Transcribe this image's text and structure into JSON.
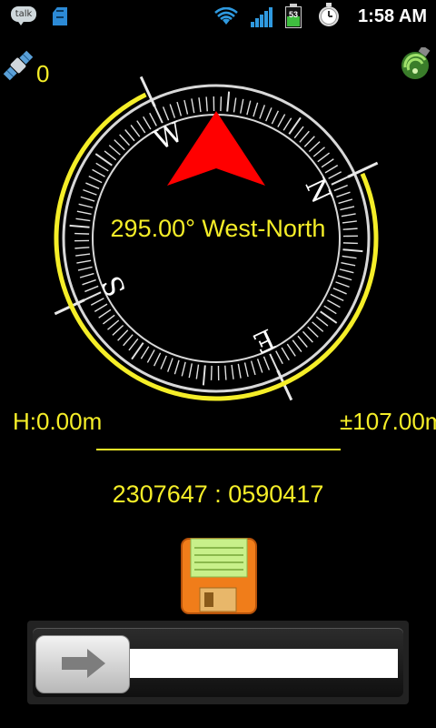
{
  "status_bar": {
    "talk_label": "talk",
    "battery_level": "53",
    "time": "1:58 AM",
    "icons": [
      "talk-icon",
      "sd-card-icon",
      "wifi-icon",
      "signal-icon",
      "battery-icon",
      "alarm-clock-icon"
    ]
  },
  "gps": {
    "satellites": "0",
    "satellite_icon": "satellite-icon",
    "status_icon": "gps-signal-icon"
  },
  "compass": {
    "heading_text": "295.00° West-North",
    "heading_degrees": 295,
    "cardinals": {
      "north": "N",
      "east": "E",
      "south": "S",
      "west": "W"
    }
  },
  "readouts": {
    "height": "H:0.00m",
    "accuracy": "±107.00m",
    "coordinates": "2307647 : 0590417"
  },
  "actions": {
    "save_icon": "floppy-disk-icon",
    "slider_icon": "arrow-right-icon"
  },
  "colors": {
    "accent": "#f5ee28",
    "arrow": "#ff0000",
    "background": "#000000"
  }
}
